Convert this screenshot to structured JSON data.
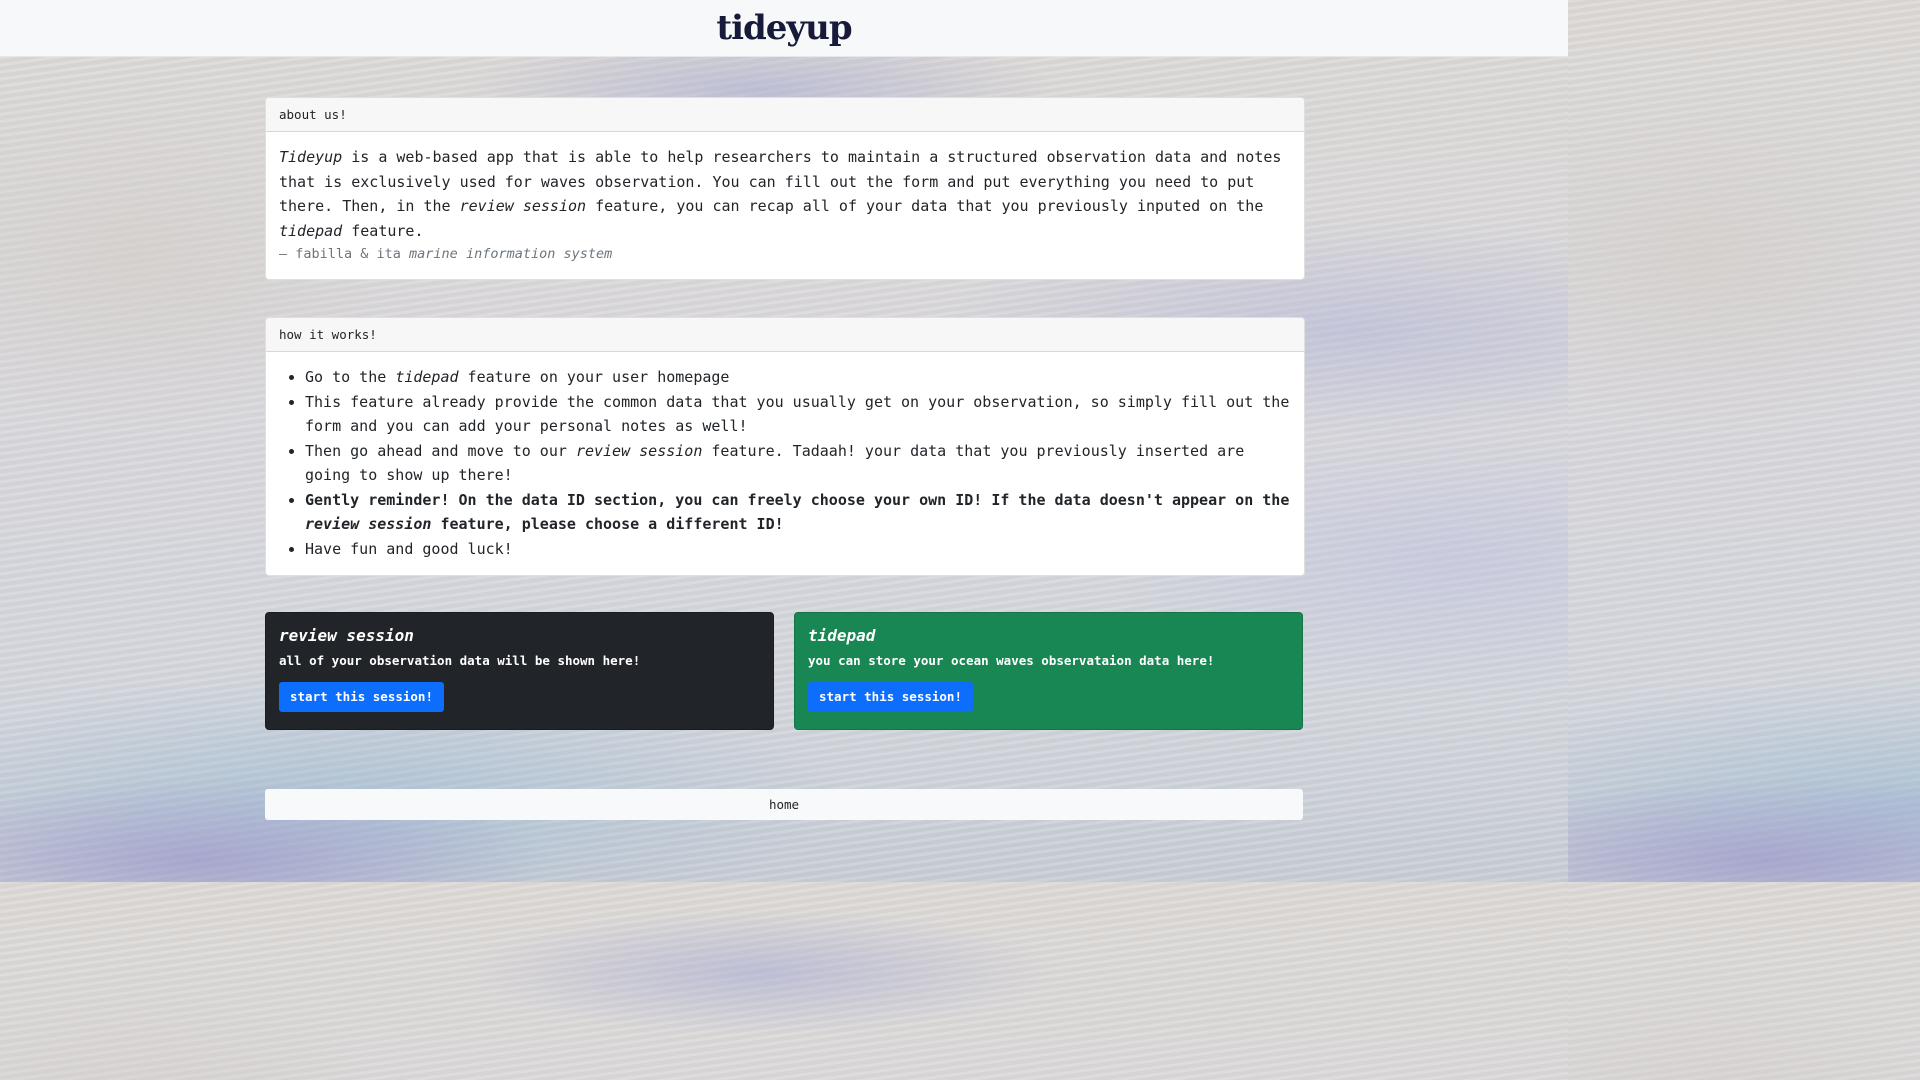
{
  "header": {
    "brand": "tideyup"
  },
  "about": {
    "header": "about us!",
    "body": {
      "app_name": "Tideyup",
      "text_1": " is a web-based app that is able to help researchers to maintain a structured observation data and notes that is exclusively used for waves observation. You can fill out the form and put everything you need to put there. Then, in the ",
      "review_session": "review session",
      "text_2": " feature, you can recap all of your data that you previously inputed on the ",
      "tidepad": "tidepad",
      "text_3": " feature."
    },
    "footer": {
      "prefix": "— fabilla & ita ",
      "source": "marine information system"
    }
  },
  "how_it_works": {
    "header": "how it works!",
    "items": [
      {
        "a": "Go to the ",
        "em": "tidepad",
        "b": " feature on your user homepage"
      },
      {
        "text": "This feature already provide the common data that you usually get on your observation, so simply fill out the form and you can add your personal notes as well!"
      },
      {
        "a": "Then go ahead and move to our ",
        "em": "review session",
        "b": " feature. Tadaah! your data that you previously inserted are going to show up there!"
      },
      {
        "a": "Gently reminder! On the data ID section, you can freely choose your own ID! If the data doesn't appear on the ",
        "em": "review session",
        "b": " feature, please choose a different ID!"
      },
      {
        "text": "Have fun and good luck!"
      }
    ]
  },
  "features": {
    "review": {
      "title": "review session",
      "text": "all of your observation data will be shown here!",
      "button": "start this session!"
    },
    "tidepad": {
      "title": "tidepad",
      "text": "you can store your ocean waves observataion data here!",
      "button": "start this session!"
    }
  },
  "footer": {
    "home": "home"
  },
  "colors": {
    "brand_text": "#171a38",
    "dark_card": "#212529",
    "green_card": "#198754",
    "primary_button": "#0d6efd"
  }
}
